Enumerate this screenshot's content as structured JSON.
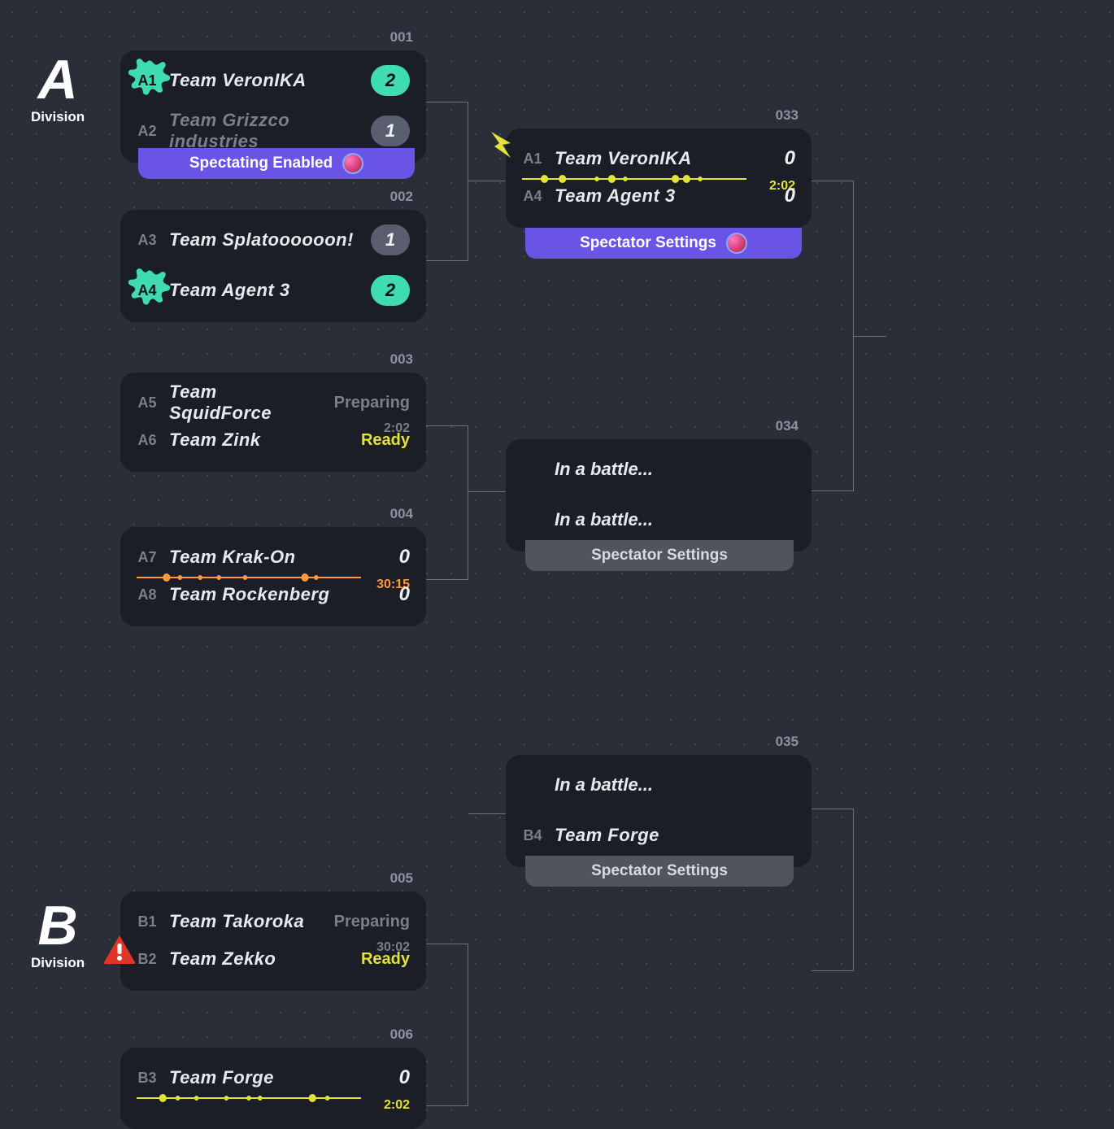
{
  "divisions": {
    "A": {
      "letter": "A",
      "word": "Division"
    },
    "B": {
      "letter": "B",
      "word": "Division"
    }
  },
  "matches": {
    "m001": {
      "num": "001",
      "top": {
        "seed": "A1",
        "name": "Team VeronIKA",
        "score": "2",
        "winner": true
      },
      "bot": {
        "seed": "A2",
        "name": "Team Grizzco industries",
        "score": "1",
        "winner": false
      },
      "spec": "Spectating Enabled"
    },
    "m002": {
      "num": "002",
      "top": {
        "seed": "A3",
        "name": "Team Splatoooooon!",
        "score": "1",
        "winner": false
      },
      "bot": {
        "seed": "A4",
        "name": "Team Agent 3",
        "score": "2",
        "winner": true
      }
    },
    "m003": {
      "num": "003",
      "top": {
        "seed": "A5",
        "name": "Team SquidForce",
        "status": "Preparing"
      },
      "bot": {
        "seed": "A6",
        "name": "Team Zink",
        "status": "Ready"
      },
      "time": "2:02"
    },
    "m004": {
      "num": "004",
      "top": {
        "seed": "A7",
        "name": "Team Krak-On",
        "score": "0"
      },
      "bot": {
        "seed": "A8",
        "name": "Team Rockenberg",
        "score": "0"
      },
      "time": "30:15"
    },
    "m005": {
      "num": "005",
      "top": {
        "seed": "B1",
        "name": "Team Takoroka",
        "status": "Preparing"
      },
      "bot": {
        "seed": "B2",
        "name": "Team Zekko",
        "status": "Ready"
      },
      "time": "30:02"
    },
    "m006": {
      "num": "006",
      "top": {
        "seed": "B3",
        "name": "Team Forge",
        "score": "0"
      },
      "time": "2:02"
    },
    "m033": {
      "num": "033",
      "top": {
        "seed": "A1",
        "name": "Team VeronIKA",
        "score": "0"
      },
      "bot": {
        "seed": "A4",
        "name": "Team Agent 3",
        "score": "0"
      },
      "time": "2:02",
      "spec": "Spectator Settings"
    },
    "m034": {
      "num": "034",
      "top_text": "In a battle...",
      "bot_text": "In a battle...",
      "spec": "Spectator Settings"
    },
    "m035": {
      "num": "035",
      "top_text": "In a battle...",
      "bot": {
        "seed": "B4",
        "name": "Team Forge"
      },
      "spec": "Spectator Settings"
    }
  },
  "colors": {
    "winner_badge": "#3fdcb0",
    "loser_badge": "#585e6e",
    "purple": "#6a54e6",
    "yellow": "#e3e336",
    "orange": "#ff9a3c"
  }
}
